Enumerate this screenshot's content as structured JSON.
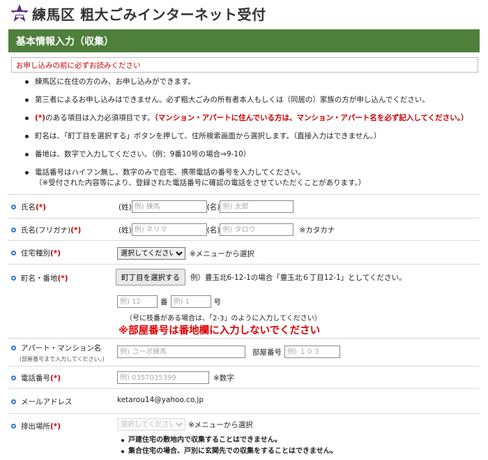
{
  "header": {
    "title": "練馬区 粗大ごみインターネット受付",
    "logo_icon": "nerima-logo-icon"
  },
  "section_title": "基本情報入力（収集）",
  "notice": "お申し込みの前に必ずお読みください",
  "rules": [
    "練馬区に在住の方のみ、お申し込みができます。",
    "第三者によるお申し込みはできません。必ず粗大ごみの所有者本人もしくは（同居の）家族の方が申し込んでください。",
    "(*)",
    "のある項目は入力必須項目です。",
    "（マンション・アパートに住んでいる方は、マンション・アパート名を必ず記入してください。）",
    "町名は、「町丁目を選択する」ボタンを押して、住所検索画面から選択します。（直接入力はできません。）",
    "番地は、数字で入力してください。（例：9番10号の場合⇒9-10）",
    "電話番号はハイフン無し、数字のみで自宅、携帯電話の番号を入力してください。",
    "（※受付された内容等により、登録された電話番号に確認の電話をさせていただくことがあります。）"
  ],
  "required_mark": "(*)",
  "form": {
    "name": {
      "label": "氏名",
      "sei_label": "(姓)",
      "sei_ph": "例) 練馬",
      "mei_label": "(名)",
      "mei_ph": "例) 太郎"
    },
    "kana": {
      "label": "氏名(フリガナ)",
      "sei_label": "(姓)",
      "sei_ph": "例) ネリマ",
      "mei_label": "(名)",
      "mei_ph": "例) タロウ",
      "hint": "※カタカナ"
    },
    "housing": {
      "label": "住宅種別",
      "selected": "選択してください",
      "hint": "※メニューから選択"
    },
    "address": {
      "label": "町名・番地",
      "button": "町丁目を選択する",
      "example": "例）豊玉北6-12-1の場合「豊玉北６丁目12-1」としてください。",
      "ban_ph": "例) 12",
      "ban_label": "番",
      "go_ph": "例) 1",
      "go_label": "号",
      "edaban": "（号に枝番がある場合は、「2-3」のように入力してください）",
      "warning": "※部屋番号は番地欄に入力しないでください"
    },
    "apartment": {
      "label": "アパート・マンション名",
      "sub": "(部屋番号まで入力してください。)",
      "ph": "例) コーポ練馬",
      "room_label": "部屋番号",
      "room_ph": "例) １０３"
    },
    "phone": {
      "label": "電話番号",
      "ph": "例) 0357035399",
      "hint": "※数字"
    },
    "email": {
      "label": "メールアドレス",
      "value": "ketarou14@yahoo.co.jp"
    },
    "disposal": {
      "label": "排出場所",
      "selected": "選択してください",
      "hint": "※メニューから選択",
      "notes": [
        "戸建住宅の敷地内で収集することはできません。",
        "集合住宅の場合、戸別に玄関先での収集をすることはできません。"
      ]
    }
  },
  "colors": {
    "green_bar": "#4e7f3b",
    "required_red": "#cc0000",
    "dot_blue": "#2a7ad0",
    "logo_purple": "#5a2a7a"
  }
}
